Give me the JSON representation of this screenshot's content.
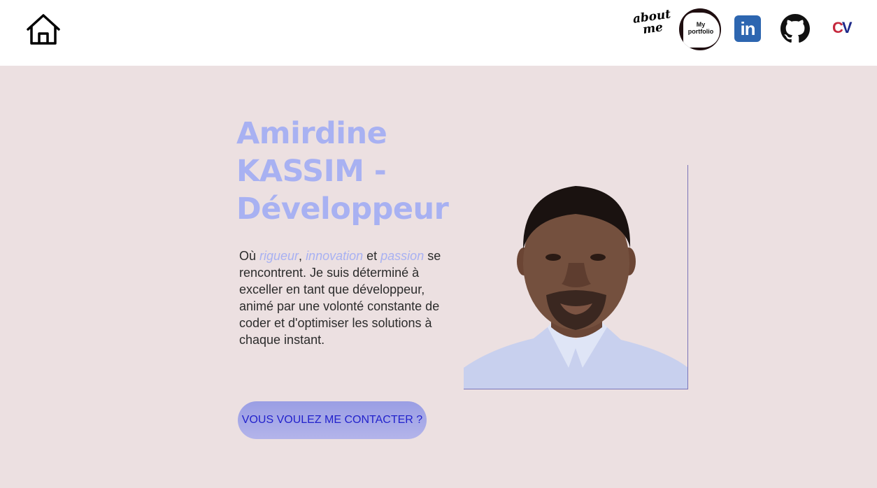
{
  "nav": {
    "home_icon": "home-icon",
    "about_line1": "about",
    "about_line2": "me",
    "portfolio_line1": "My",
    "portfolio_line2": "portfolio",
    "linkedin_label": "in",
    "github_icon": "github-icon",
    "cv_c": "C",
    "cv_v": "V"
  },
  "hero": {
    "title": "Amirdine KASSIM - Développeur",
    "text_prefix": "Où ",
    "kw1": "rigueur",
    "sep1": ", ",
    "kw2": "innovation",
    "sep2": " et ",
    "kw3": "passion",
    "text_rest": " se rencontrent. Je suis déterminé à exceller en tant que développeur, animé par une volonté constante de coder et d'optimiser les solutions à chaque instant.",
    "cta_label": "VOUS VOULEZ ME CONTACTER ?"
  },
  "colors": {
    "background": "#ece0e1",
    "accent": "#a8b1f2",
    "cta_text": "#2222cc",
    "linkedin": "#2d66b0"
  }
}
